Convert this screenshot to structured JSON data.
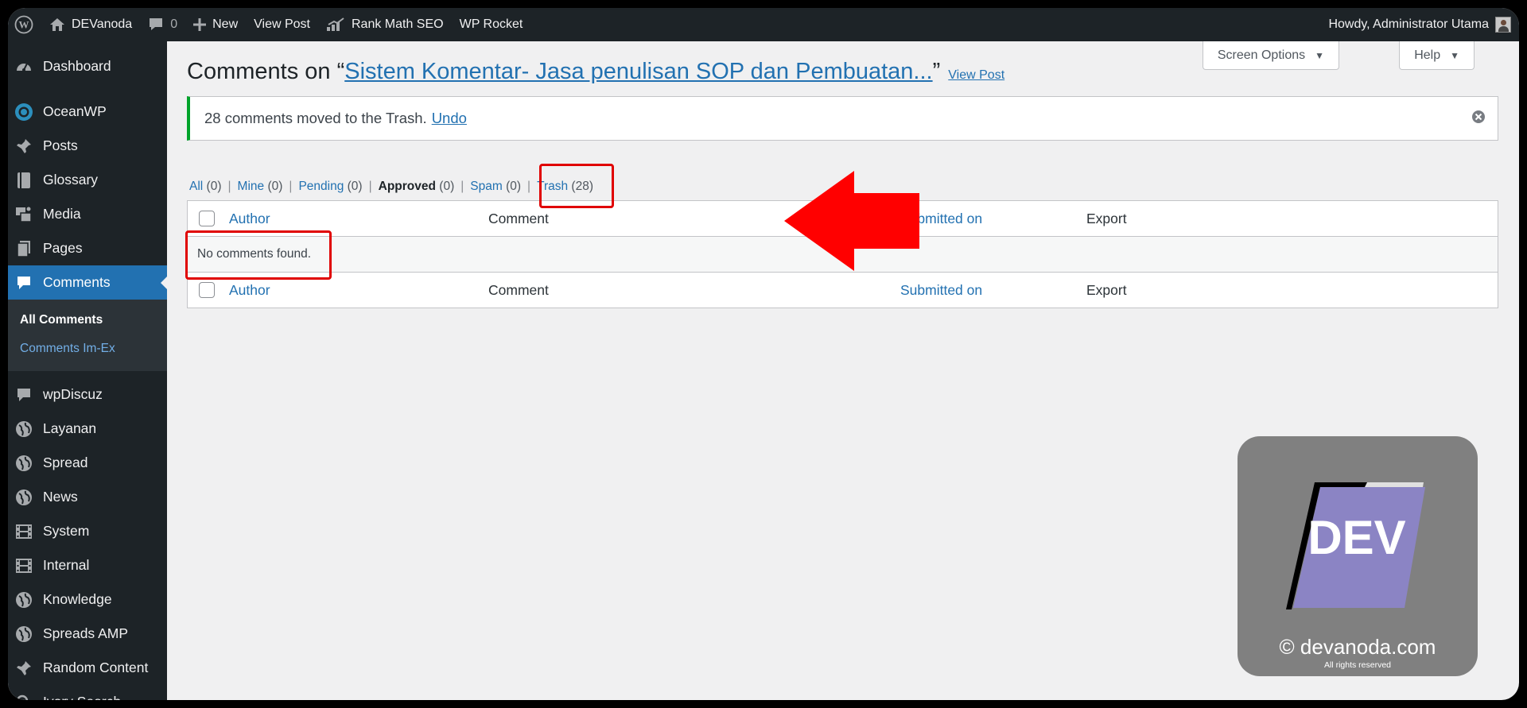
{
  "adminbar": {
    "site_name": "DEVanoda",
    "comments_count": "0",
    "new_label": "New",
    "view_post": "View Post",
    "rank_math": "Rank Math SEO",
    "wp_rocket": "WP Rocket",
    "howdy": "Howdy, Administrator Utama"
  },
  "sidebar": {
    "items": [
      {
        "label": "Dashboard",
        "icon": "dashboard-icon"
      },
      {
        "label": "OceanWP",
        "icon": "oceanwp-icon"
      },
      {
        "label": "Posts",
        "icon": "pin-icon"
      },
      {
        "label": "Glossary",
        "icon": "book-icon"
      },
      {
        "label": "Media",
        "icon": "media-icon"
      },
      {
        "label": "Pages",
        "icon": "pages-icon"
      },
      {
        "label": "Comments",
        "icon": "comment-icon"
      },
      {
        "label": "wpDiscuz",
        "icon": "comment-icon"
      },
      {
        "label": "Layanan",
        "icon": "globe-icon"
      },
      {
        "label": "Spread",
        "icon": "globe-icon"
      },
      {
        "label": "News",
        "icon": "globe-icon"
      },
      {
        "label": "System",
        "icon": "film-icon"
      },
      {
        "label": "Internal",
        "icon": "film-icon"
      },
      {
        "label": "Knowledge",
        "icon": "globe-icon"
      },
      {
        "label": "Spreads AMP",
        "icon": "globe-icon"
      },
      {
        "label": "Random Content",
        "icon": "pin-icon"
      },
      {
        "label": "Ivory Search",
        "icon": "search-icon"
      }
    ],
    "submenu": {
      "all_comments": "All Comments",
      "comments_imex": "Comments Im-Ex"
    }
  },
  "header": {
    "screen_options": "Screen Options",
    "help": "Help",
    "title_prefix": "Comments on “",
    "post_title": "Sistem Komentar- Jasa penulisan SOP dan Pembuatan...",
    "title_suffix": "”",
    "view_post": "View Post"
  },
  "notice": {
    "message": "28 comments moved to the Trash.",
    "undo": "Undo"
  },
  "filters": {
    "all": "All",
    "all_count": "(0)",
    "mine": "Mine",
    "mine_count": "(0)",
    "pending": "Pending",
    "pending_count": "(0)",
    "approved": "Approved",
    "approved_count": "(0)",
    "spam": "Spam",
    "spam_count": "(0)",
    "trash": "Trash",
    "trash_count": "(28)"
  },
  "table": {
    "columns": {
      "author": "Author",
      "comment": "Comment",
      "submitted": "Submitted on",
      "export": "Export"
    },
    "empty": "No comments found."
  },
  "watermark": {
    "logo_text": "DEV",
    "site": "© devanoda.com",
    "rights": "All rights reserved"
  },
  "colors": {
    "admin_dark": "#1d2327",
    "accent": "#2271b1",
    "annotation_red": "#e00000",
    "notice_green": "#00a32a"
  }
}
